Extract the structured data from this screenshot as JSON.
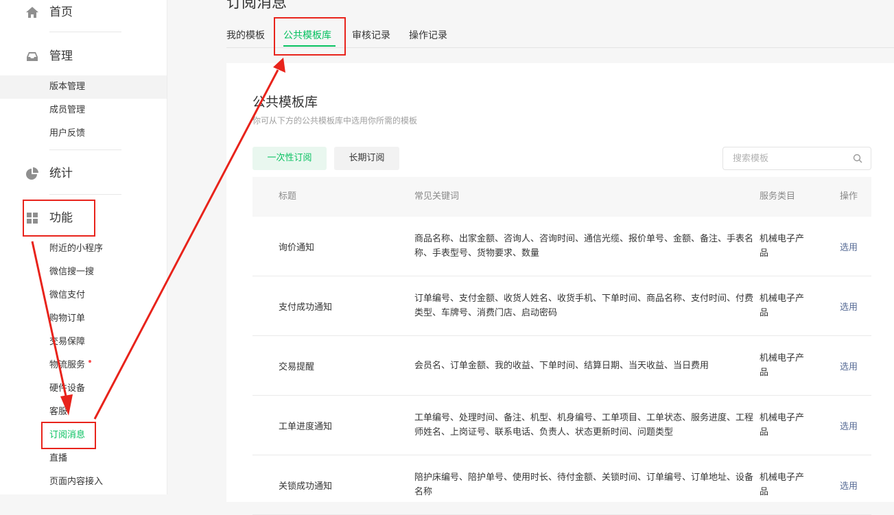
{
  "sidebar": {
    "home": "首页",
    "manage": "管理",
    "manage_items": [
      "版本管理",
      "成员管理",
      "用户反馈"
    ],
    "stats": "统计",
    "features": "功能",
    "feature_items": [
      "附近的小程序",
      "微信搜一搜",
      "微信支付",
      "购物订单",
      "交易保障",
      "物流服务",
      "硬件设备",
      "客服",
      "订阅消息",
      "直播",
      "页面内容接入"
    ],
    "active_item": "订阅消息"
  },
  "page": {
    "title": "订阅消息"
  },
  "tabs": [
    "我的模板",
    "公共模板库",
    "审核记录",
    "操作记录"
  ],
  "active_tab": "公共模板库",
  "card": {
    "title": "公共模板库",
    "desc": "你可从下方的公共模板库中选用你所需的模板",
    "btn_one_time": "一次性订阅",
    "btn_long_term": "长期订阅",
    "search_placeholder": "搜索模板"
  },
  "table": {
    "headers": [
      "标题",
      "常见关键词",
      "服务类目",
      "操作"
    ],
    "rows": [
      {
        "title": "询价通知",
        "keywords": "商品名称、出家金额、咨询人、咨询时间、通信光缆、报价单号、金额、备注、手表名称、手表型号、货物要求、数量",
        "category": "机械电子产品",
        "action": "选用"
      },
      {
        "title": "支付成功通知",
        "keywords": "订单编号、支付金额、收货人姓名、收货手机、下单时间、商品名称、支付时间、付费类型、车牌号、消费门店、启动密码",
        "category": "机械电子产品",
        "action": "选用"
      },
      {
        "title": "交易提醒",
        "keywords": "会员名、订单金额、我的收益、下单时间、结算日期、当天收益、当日费用",
        "category": "机械电子产品",
        "action": "选用"
      },
      {
        "title": "工单进度通知",
        "keywords": "工单编号、处理时间、备注、机型、机身编号、工单项目、工单状态、服务进度、工程师姓名、上岗证号、联系电话、负责人、状态更新时间、问题类型",
        "category": "机械电子产品",
        "action": "选用"
      },
      {
        "title": "关锁成功通知",
        "keywords": "陪护床编号、陪护单号、使用时长、待付金额、关锁时间、订单编号、订单地址、设备名称",
        "category": "机械电子产品",
        "action": "选用"
      }
    ]
  },
  "colors": {
    "accent": "#07c160",
    "link": "#576b95",
    "annotation": "#e8231b"
  }
}
